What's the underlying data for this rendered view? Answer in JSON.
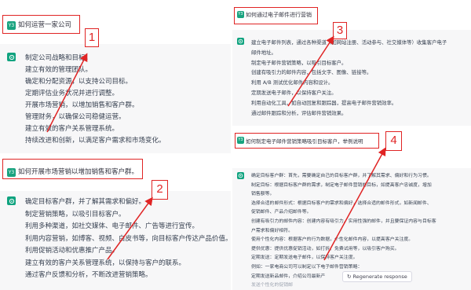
{
  "user_avatar_text": "Y3",
  "panels": [
    {
      "question": "如何运营一家公司",
      "marker": "1",
      "answer": [
        "制定公司战略和目标。",
        "建立有效的管理团队。",
        "确定和分配资源，以支持公司目标。",
        "定期评估业务状况并进行调整。",
        "开展市场营销，以增加销售和客户群。",
        "管理财务，以确保公司稳健运营。",
        "建立有效的客户关系管理系统。",
        "持续改进和创新，以满足客户需求和市场变化。"
      ]
    },
    {
      "question": "如何开展市场营销以增加销售和客户群。",
      "marker": "2",
      "answer": [
        "确定目标客户群，并了解其需求和偏好。",
        "制定营销策略，以吸引目标客户。",
        "利用多种渠道，如社交媒体、电子邮件、广告等进行宣传。",
        "利用内容营销，如博客、视频、白皮书等，向目标客户传达产品价值。",
        "利用促销活动和优惠推广产品。",
        "建立有效的客户关系管理系统，以保持与客户的联系。",
        "通过客户反馈和分析，不断改进营销策略。"
      ]
    },
    {
      "question": "如何通过电子邮件进行营销",
      "marker": "3",
      "answer": [
        "建立电子邮件列表，通过各种渠道（如网站注册、活动参与、社交媒体等）收集客户电子",
        "邮件地址。",
        "制定电子邮件营销策略，以吸引目标客户。",
        "创建有吸引力的邮件内容，包括文字、图像、链接等。",
        "利用 A/B 测试优化邮件内容和设计。",
        "定期发送电子邮件，以保持客户关注。",
        "利用自动化工具，如自动回复和跟踪器，提高电子邮件营销效率。",
        "通过邮件跟踪和分析，评估邮件营销效果。"
      ]
    },
    {
      "question": "如何制定电子邮件营销策略吸引目标客户，举例说明",
      "marker": "4",
      "answer": [
        "确定目标客户群：首先，需要确定自己的目标客户群，并了解其需求、偏好和行为习惯。",
        "制定目标：根据目标客户群的需求，制定电子邮件营销的目标，如提高客户忠诚度，增加",
        "销售额等。",
        "选择合适的邮件形式：根据目标客户的需求和偏好，选择合适的邮件形式，如新闻邮件、",
        "促销邮件、产品介绍邮件等。",
        "创建有吸引力的邮件内容：创建内容有吸引力、实用性强的邮件，并且要保证内容与目标客",
        "户需求和偏好相符。",
        "使用个性化内容：根据客户的行为数据，个性化邮件内容，以提高客户关注度。",
        "提供优惠：提供优惠促销活动，如打折、免费试用等，以吸引客户购买。",
        "定期发送：定期发送电子邮件，以保持客户关注度。",
        "例如：一家电商公司可以制定以下电子邮件营销策略：",
        "定期发送新品邮件，介绍公司最新产",
        "发送个性化的促销邮"
      ]
    }
  ],
  "regenerate_label": "Regenerate response",
  "colors": {
    "annotation": "#e02424",
    "chatgpt_green": "#10a37f",
    "answer_bg": "#f7f7f8"
  }
}
